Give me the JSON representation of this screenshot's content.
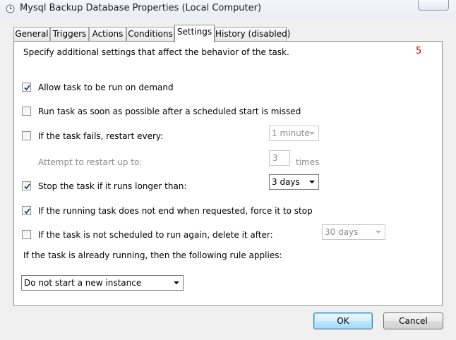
{
  "window": {
    "title": "Mysql Backup Database Properties (Local Computer)",
    "icon": "clock-icon"
  },
  "tabs": [
    {
      "label": "General",
      "active": false
    },
    {
      "label": "Triggers",
      "active": false
    },
    {
      "label": "Actions",
      "active": false
    },
    {
      "label": "Conditions",
      "active": false
    },
    {
      "label": "Settings",
      "active": true
    },
    {
      "label": "History (disabled)",
      "active": false
    }
  ],
  "settings": {
    "description": "Specify additional settings that affect the behavior of the task.",
    "annotation_number": "5",
    "allow_on_demand": {
      "label": "Allow task to be run on demand",
      "checked": true
    },
    "run_missed": {
      "label": "Run task as soon as possible after a scheduled start is missed",
      "checked": false
    },
    "restart_on_fail": {
      "label": "If the task fails, restart every:",
      "checked": false,
      "interval": "1 minute"
    },
    "restart_attempts": {
      "label": "Attempt to restart up to:",
      "value": "3",
      "unit": "times"
    },
    "stop_if_longer": {
      "label": "Stop the task if it runs longer than:",
      "checked": true,
      "duration": "3 days"
    },
    "force_stop": {
      "label": "If the running task does not end when requested, force it to stop",
      "checked": true
    },
    "delete_after": {
      "label": "If the task is not scheduled to run again, delete it after:",
      "checked": false,
      "duration": "30 days"
    },
    "running_rule_label": "If the task is already running, then the following rule applies:",
    "running_rule_value": "Do not start a new instance"
  },
  "buttons": {
    "ok": "OK",
    "cancel": "Cancel"
  },
  "colors": {
    "annotation": "#c00000",
    "default_button_border": "#3c7fb1"
  }
}
